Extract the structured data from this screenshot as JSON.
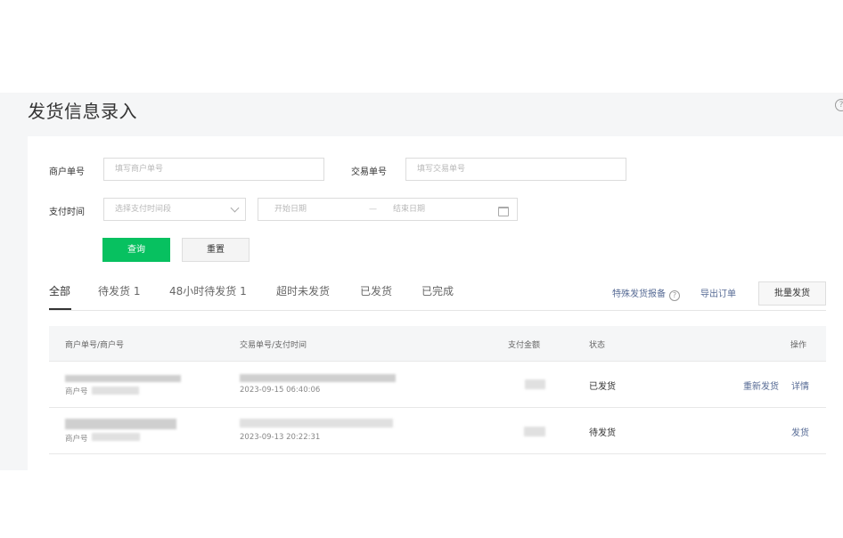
{
  "page": {
    "title": "发货信息录入"
  },
  "filters": {
    "merchant_order_label": "商户单号",
    "merchant_order_placeholder": "填写商户单号",
    "trade_no_label": "交易单号",
    "trade_no_placeholder": "填写交易单号",
    "pay_time_label": "支付时间",
    "pay_time_select_placeholder": "选择支付时间段",
    "date_start_placeholder": "开始日期",
    "date_separator": "—",
    "date_end_placeholder": "结束日期",
    "query_button": "查询",
    "reset_button": "重置"
  },
  "tabs": [
    {
      "label": "全部",
      "active": true
    },
    {
      "label": "待发货 1"
    },
    {
      "label": "48小时待发货 1"
    },
    {
      "label": "超时未发货"
    },
    {
      "label": "已发货"
    },
    {
      "label": "已完成"
    }
  ],
  "toolbar": {
    "special_report": "特殊发货报备",
    "export_orders": "导出订单",
    "batch_ship": "批量发货"
  },
  "table": {
    "columns": [
      "商户单号/商户号",
      "交易单号/支付时间",
      "支付金额",
      "状态",
      "操作"
    ],
    "rows": [
      {
        "merchant_label": "商户号",
        "pay_time": "2023-09-15 06:40:06",
        "status": "已发货",
        "actions": [
          "重新发货",
          "详情"
        ]
      },
      {
        "merchant_label": "商户号",
        "pay_time": "2023-09-13 20:22:31",
        "status": "待发货",
        "actions": [
          "发货"
        ]
      }
    ]
  },
  "colors": {
    "primary": "#07c160",
    "link": "#576b95",
    "band": "#f5f6f7"
  },
  "icons": [
    "help-icon",
    "question-circle-icon",
    "chevron-down-icon",
    "calendar-icon"
  ]
}
